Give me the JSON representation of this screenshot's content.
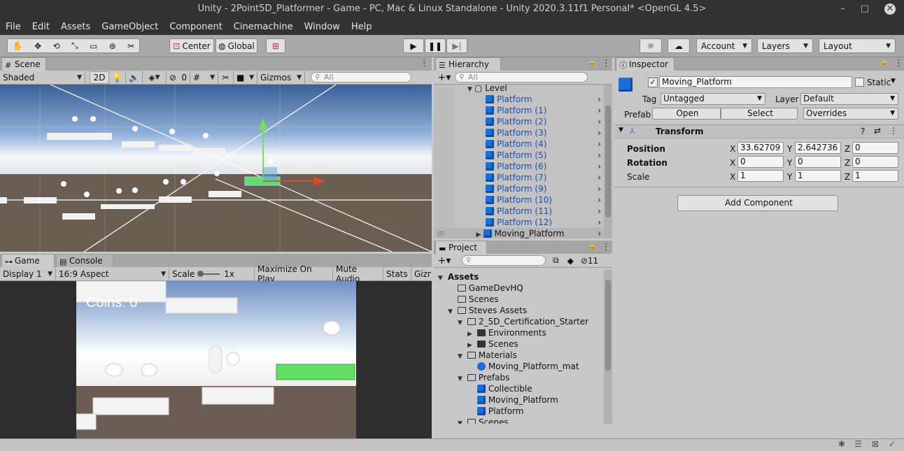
{
  "window": {
    "title": "Unity - 2Point5D_Platformer - Game - PC, Mac & Linux Standalone - Unity 2020.3.11f1 Personal* <OpenGL 4.5>",
    "minimize": "–",
    "maximize": "□",
    "close": "✕"
  },
  "menu": [
    "File",
    "Edit",
    "Assets",
    "GameObject",
    "Component",
    "Cinemachine",
    "Window",
    "Help"
  ],
  "toolbar": {
    "center": "Center",
    "global": "Global",
    "account": "Account",
    "layers": "Layers",
    "layout": "Layout"
  },
  "scene": {
    "tab": "Scene",
    "shading": "Shaded",
    "mode2d": "2D",
    "hidden_count": "0",
    "gizmos": "Gizmos",
    "search_placeholder": "All"
  },
  "game": {
    "tab": "Game",
    "console_tab": "Console",
    "display": "Display 1",
    "aspect": "16:9 Aspect",
    "scale_label": "Scale",
    "scale_value": "1x",
    "maximize": "Maximize On Play",
    "mute": "Mute Audio",
    "stats": "Stats",
    "gizmos": "Gizm",
    "coins_text": "Coins: 0"
  },
  "hierarchy": {
    "tab": "Hierarchy",
    "search_placeholder": "All",
    "root": "Level",
    "items": [
      "Platform",
      "Platform (1)",
      "Platform (2)",
      "Platform (3)",
      "Platform (4)",
      "Platform (5)",
      "Platform (6)",
      "Platform (7)",
      "Platform (9)",
      "Platform (10)",
      "Platform (11)",
      "Platform (12)"
    ],
    "last": "Moving_Platform"
  },
  "project": {
    "tab": "Project",
    "hidden_count": "11",
    "tree": [
      {
        "label": "Assets",
        "indent": 0,
        "arrow": "▼",
        "icon": "none",
        "bold": true
      },
      {
        "label": "GameDevHQ",
        "indent": 1,
        "arrow": "",
        "icon": "folder"
      },
      {
        "label": "Scenes",
        "indent": 1,
        "arrow": "",
        "icon": "folder"
      },
      {
        "label": "Steves Assets",
        "indent": 1,
        "arrow": "▼",
        "icon": "folder"
      },
      {
        "label": "2_5D_Certification_Starter",
        "indent": 2,
        "arrow": "▼",
        "icon": "folder"
      },
      {
        "label": "Environments",
        "indent": 3,
        "arrow": "▶",
        "icon": "folder-full"
      },
      {
        "label": "Scenes",
        "indent": 3,
        "arrow": "▶",
        "icon": "folder-full"
      },
      {
        "label": "Materials",
        "indent": 2,
        "arrow": "▼",
        "icon": "folder"
      },
      {
        "label": "Moving_Platform_mat",
        "indent": 3,
        "arrow": "",
        "icon": "sphere"
      },
      {
        "label": "Prefabs",
        "indent": 2,
        "arrow": "▼",
        "icon": "folder"
      },
      {
        "label": "Collectible",
        "indent": 3,
        "arrow": "",
        "icon": "cube"
      },
      {
        "label": "Moving_Platform",
        "indent": 3,
        "arrow": "",
        "icon": "cube"
      },
      {
        "label": "Platform",
        "indent": 3,
        "arrow": "",
        "icon": "cube"
      },
      {
        "label": "Scenes",
        "indent": 2,
        "arrow": "▼",
        "icon": "folder"
      }
    ]
  },
  "inspector": {
    "tab": "Inspector",
    "name": "Moving_Platform",
    "static": "Static",
    "tag_label": "Tag",
    "tag": "Untagged",
    "layer_label": "Layer",
    "layer": "Default",
    "prefab_label": "Prefab",
    "open": "Open",
    "select": "Select",
    "overrides": "Overrides",
    "component": "Transform",
    "position_label": "Position",
    "rotation_label": "Rotation",
    "scale_label": "Scale",
    "position": {
      "x": "33.62709",
      "y": "2.642736",
      "z": "0"
    },
    "rotation": {
      "x": "0",
      "y": "0",
      "z": "0"
    },
    "scale": {
      "x": "1",
      "y": "1",
      "z": "1"
    },
    "add_component": "Add Component"
  },
  "colors": {
    "editor_bg": "#c8c8c8",
    "titlebar": "#323232",
    "selected_blue": "#1a6ed8",
    "green_platform": "#63e064"
  }
}
